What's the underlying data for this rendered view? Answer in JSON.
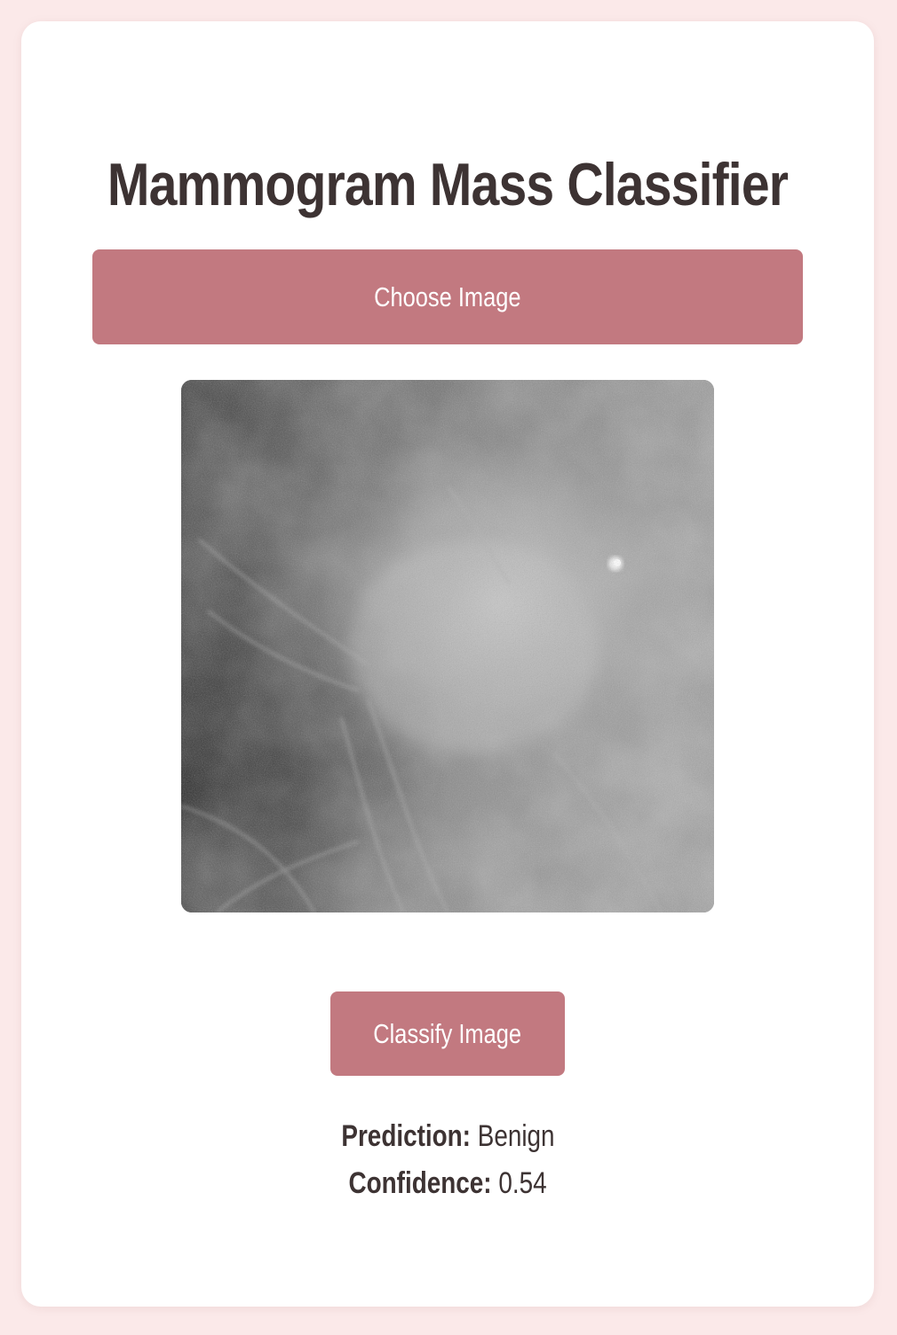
{
  "app": {
    "title": "Mammogram Mass Classifier"
  },
  "upload": {
    "choose_label": "Choose Image"
  },
  "actions": {
    "classify_label": "Classify Image"
  },
  "result": {
    "prediction_label": "Prediction:",
    "prediction_value": "Benign",
    "confidence_label": "Confidence:",
    "confidence_value": "0.54"
  },
  "colors": {
    "page_background": "#fbe9e9",
    "card_background": "#ffffff",
    "accent": "#c27980",
    "text": "#3d3333"
  }
}
